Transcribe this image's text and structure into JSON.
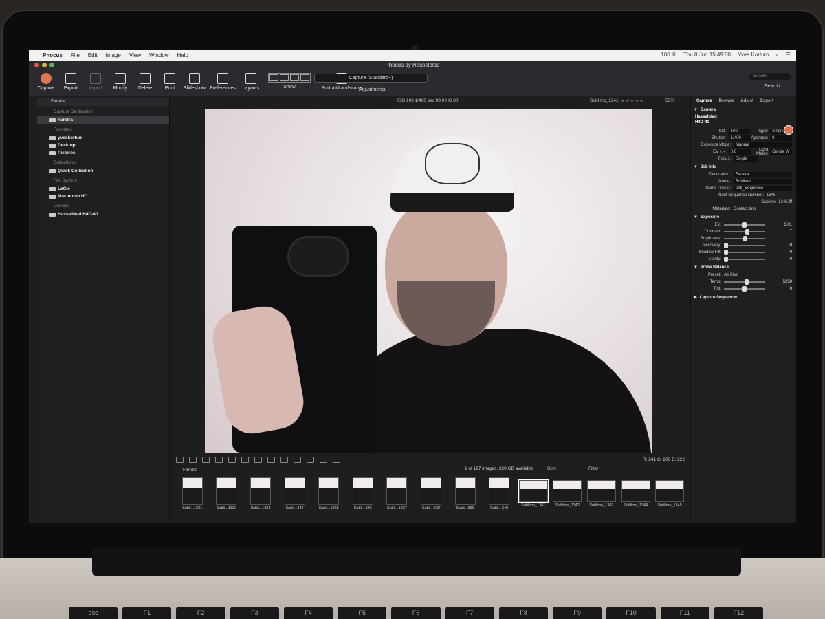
{
  "menubar": {
    "app_name": "Phocus",
    "menus": [
      "File",
      "Edit",
      "Image",
      "View",
      "Window",
      "Help"
    ],
    "battery": "100 %",
    "datetime": "Thu 8 Jun  15:49:00",
    "user": "Yves Kortum"
  },
  "window": {
    "title": "Phocus by Hasselblad"
  },
  "toolbar": {
    "capture": "Capture",
    "export": "Export",
    "import": "Import",
    "modify": "Modify",
    "delete": "Delete",
    "print": "Print",
    "slideshow": "Slideshow",
    "preferences": "Preferences",
    "layouts": "Layouts",
    "show": "Show",
    "portrait_landscape": "Portrait/Landscape",
    "adjustments_preset": "Capture (Standard+)",
    "adjustments": "Adjustments",
    "search_placeholder": "Search",
    "search": "Search"
  },
  "left_panel": {
    "folder_popup": "Faretra",
    "sections": {
      "capture_destination": "Capture Destination",
      "favorites": "Favorites",
      "collections": "Collections",
      "file_system": "File System",
      "devices": "Devices"
    },
    "items": {
      "faretra": "Faretra",
      "home": "yveskortum",
      "desktop": "Desktop",
      "pictures": "Pictures",
      "quick_collection": "Quick Collection",
      "lacie": "LaCie",
      "macintosh_hd": "Macintosh HD",
      "hasselblad": "Hasselblad H4D-40"
    }
  },
  "viewer": {
    "meta": "ISO 100   1/400 sec   f/8.0   HC 80",
    "image_name": "Sublimo_1341",
    "rating": "★★★★★",
    "zoom": "53%",
    "rgb_readout": "R: 241  G: 206  B: 222"
  },
  "filmstrip": {
    "folder": "Faretra",
    "count": "1 of 197 images, 320 GB available",
    "sort_label": "Sort:",
    "filter_label": "Filter:",
    "thumbs": [
      "Subli...1331",
      "Subli...1332",
      "Subli...1333",
      "Subli...334",
      "Subli...1335",
      "Subli...336",
      "Subli...1337",
      "Subli...338",
      "Subli...339",
      "Subli...340",
      "Sublimo_1341",
      "Sublimo_1342",
      "Sublimo_1343",
      "Sublimo_1344",
      "Sublimo_1345"
    ]
  },
  "right_panel": {
    "tabs": [
      "Capture",
      "Browse",
      "Adjust",
      "Export"
    ],
    "camera": {
      "title": "Camera",
      "model_line1": "Hasselblad",
      "model_line2": "H4D-40",
      "iso_label": "ISO:",
      "iso": "100",
      "type_label": "Type:",
      "type": "Single",
      "shutter_label": "Shutter:",
      "shutter": "1/400",
      "aperture_label": "Aperture:",
      "aperture": "8",
      "exposure_mode_label": "Exposure Mode:",
      "exposure_mode": "Manual",
      "ev_label": "EV +/-:",
      "ev": "0,0",
      "light_meter_label": "Light Meter:",
      "light_meter": "Centre W",
      "focus_label": "Focus:",
      "focus": "Single"
    },
    "job_info": {
      "title": "Job Info",
      "destination_label": "Destination:",
      "destination": "Faretra",
      "name_label": "Name:",
      "name": "Sublimo",
      "name_preset_label": "Name Preset:",
      "name_preset": "Job_Sequence",
      "next_seq_label": "Next Sequence Number:",
      "next_seq": "1346",
      "next_file": "Sublimo_1346.fff",
      "metadata_label": "Metadata:",
      "metadata": "Contact Info"
    },
    "exposure": {
      "title": "Exposure",
      "ev_label": "EV:",
      "ev": "0,01",
      "contrast_label": "Contrast:",
      "contrast": "7",
      "brightness_label": "Brightness:",
      "brightness": "1",
      "recovery_label": "Recovery:",
      "recovery": "0",
      "shadow_fill_label": "Shadow Fill:",
      "shadow_fill": "0",
      "clarity_label": "Clarity:",
      "clarity": "0"
    },
    "white_balance": {
      "title": "White Balance",
      "preset_label": "Preset:",
      "preset": "As Shot",
      "temp_label": "Temp:",
      "temp": "5250",
      "tint_label": "Tint:",
      "tint": "0"
    },
    "capture_sequencer": {
      "title": "Capture Sequencer"
    }
  },
  "keyboard": [
    "esc",
    "F1",
    "F2",
    "F3",
    "F4",
    "F5",
    "F6",
    "F7",
    "F8",
    "F9",
    "F10",
    "F11",
    "F12"
  ],
  "colors": {
    "capture_red": "#e07550",
    "panel_bg": "#1f1e21"
  }
}
